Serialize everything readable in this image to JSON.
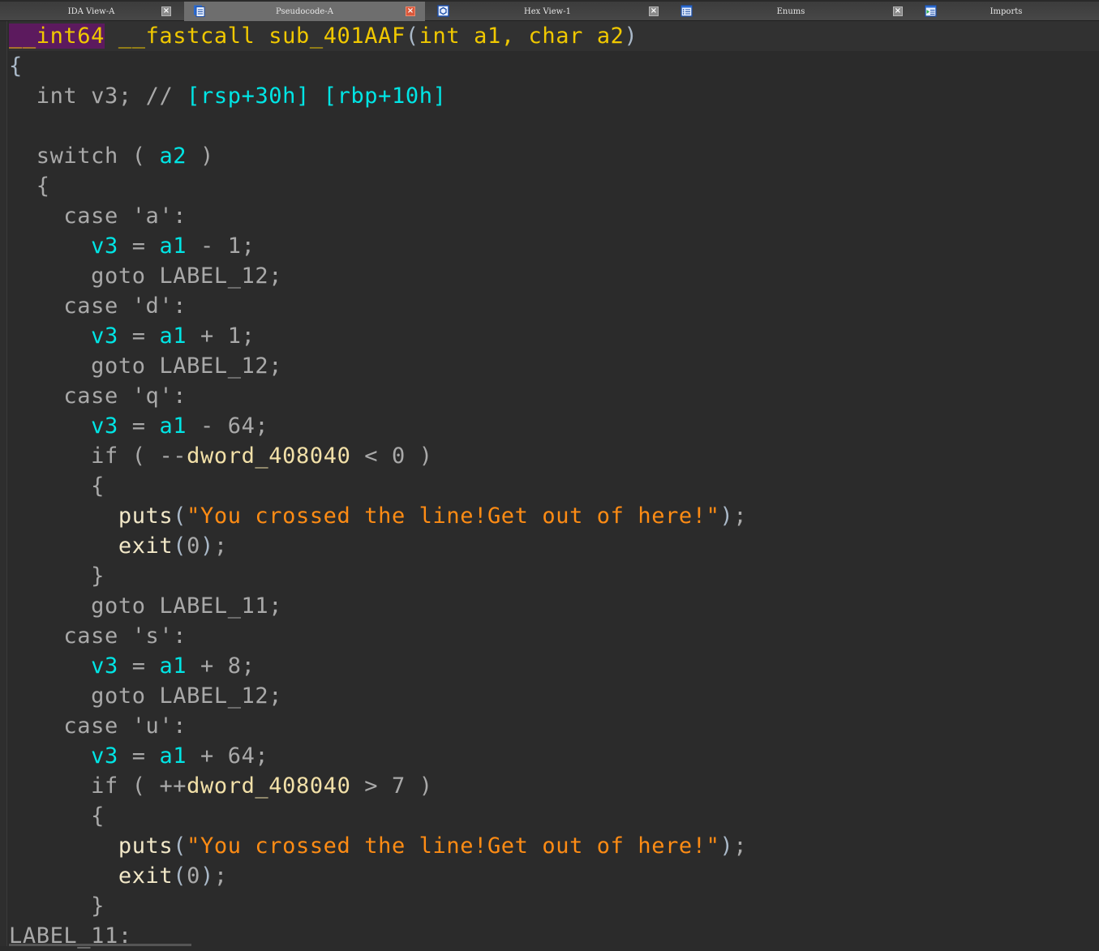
{
  "tabs": [
    {
      "label": "IDA View-A",
      "icon": "ida-view-icon",
      "active": false
    },
    {
      "label": "Pseudocode-A",
      "icon": "pseudocode-icon",
      "active": true
    },
    {
      "label": "Hex View-1",
      "icon": "hex-view-icon",
      "active": false
    },
    {
      "label": "Enums",
      "icon": "enums-icon",
      "active": false
    },
    {
      "label": "Imports",
      "icon": "imports-icon",
      "active": false
    }
  ],
  "code": {
    "signature": {
      "ret_prefix": "__",
      "ret_type": "int64",
      "callconv": "__fastcall",
      "name": "sub_401AAF",
      "params": "int a1, char a2"
    },
    "lines": {
      "open_brace": "{",
      "decl_kw": "int",
      "decl_var": "v3",
      "decl_comment": "// ",
      "decl_loc1": "[rsp+30h]",
      "decl_loc2": "[rbp+10h]",
      "switch_kw": "switch",
      "switch_var": "a2",
      "case_a": "case 'a':",
      "case_a_expr": " - 1;",
      "goto_12": "goto LABEL_12;",
      "case_d": "case 'd':",
      "case_d_expr": " + 1;",
      "case_q": "case 'q':",
      "case_q_expr": " - 64;",
      "if_kw": "if",
      "glob": "dword_408040",
      "if_q_op": "--",
      "if_q_cond": " < 0 )",
      "puts_fn": "puts",
      "message": "\"You crossed the line!Get out of here!\"",
      "exit_fn": "exit",
      "exit_arg": "0",
      "goto_11": "goto LABEL_11;",
      "case_s": "case 's':",
      "case_s_expr": " + 8;",
      "case_u": "case 'u':",
      "case_u_expr": " + 64;",
      "if_u_op": "++",
      "if_u_cond": " > 7 )",
      "v3": "v3",
      "a1": "a1",
      "label_11": "LABEL_11:"
    }
  }
}
